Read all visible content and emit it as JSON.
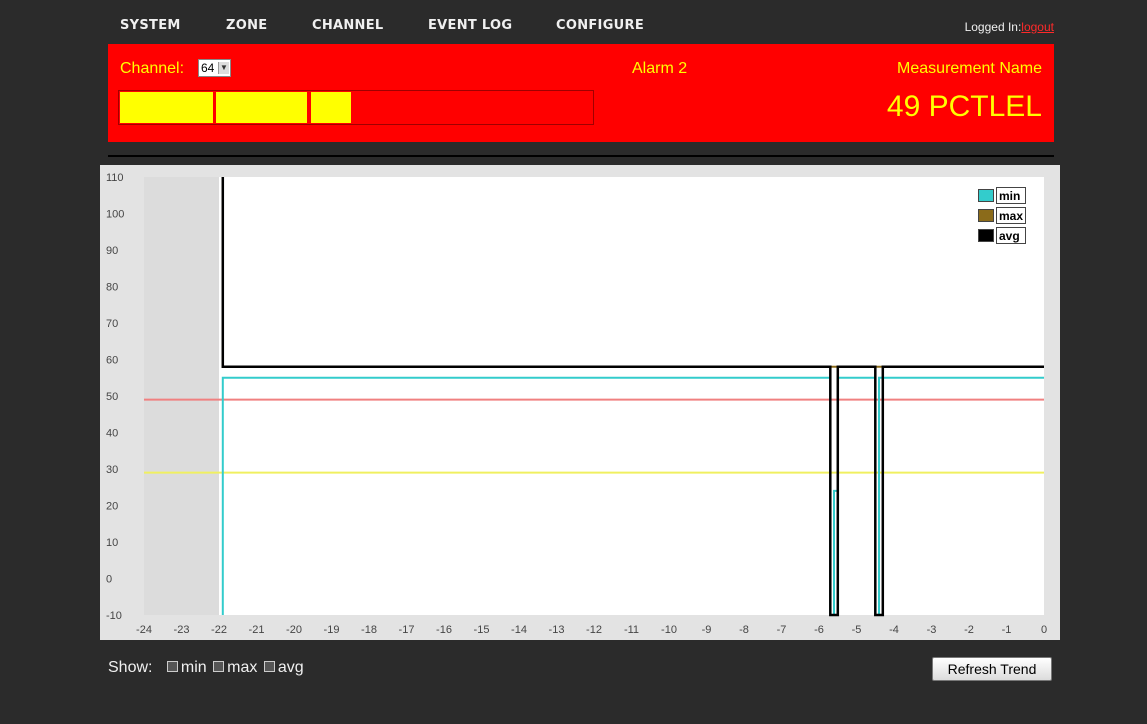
{
  "nav": {
    "items": [
      "SYSTEM",
      "ZONE",
      "CHANNEL",
      "EVENT LOG",
      "CONFIGURE"
    ],
    "logged_in_label": "Logged In:",
    "logout_label": "logout"
  },
  "banner": {
    "channel_label": "Channel:",
    "channel_value": "64",
    "alarm_name": "Alarm 2",
    "measurement_label": "Measurement Name",
    "measurement_value": "49 PCTLEL",
    "level_fraction": 0.49,
    "colors": {
      "background": "#ff0000",
      "text": "#ffff00",
      "fill": "#ffff00"
    }
  },
  "chart_data": {
    "type": "line",
    "title": "",
    "xlabel": "",
    "ylabel": "",
    "x_ticks": [
      -24,
      -23,
      -22,
      -21,
      -20,
      -19,
      -18,
      -17,
      -16,
      -15,
      -14,
      -13,
      -12,
      -11,
      -10,
      -9,
      -8,
      -7,
      -6,
      -5,
      -4,
      -3,
      -2,
      -1,
      0
    ],
    "y_ticks": [
      -10,
      0,
      10,
      20,
      30,
      40,
      50,
      60,
      70,
      80,
      90,
      100,
      110
    ],
    "xlim": [
      -24,
      0
    ],
    "ylim": [
      -10,
      110
    ],
    "grid": false,
    "legend_position": "top-right",
    "no_data_region": [
      -24,
      -22
    ],
    "thresholds": [
      {
        "value": 49,
        "color": "#f08080"
      },
      {
        "value": 29,
        "color": "#f0f060"
      }
    ],
    "series": [
      {
        "name": "min",
        "color": "#33cccc",
        "points": [
          [
            -21.9,
            -10
          ],
          [
            -21.9,
            55
          ],
          [
            -5.7,
            55
          ],
          [
            -5.7,
            -10
          ],
          [
            -5.6,
            -10
          ],
          [
            -5.6,
            24
          ],
          [
            -5.5,
            24
          ],
          [
            -5.5,
            55
          ],
          [
            -4.5,
            55
          ],
          [
            -4.5,
            -10
          ],
          [
            -4.4,
            -10
          ],
          [
            -4.4,
            55
          ],
          [
            0,
            55
          ]
        ]
      },
      {
        "name": "max",
        "color": "#8b6b1a",
        "points": [
          [
            -21.9,
            110
          ],
          [
            -21.9,
            58
          ],
          [
            0,
            58
          ]
        ]
      },
      {
        "name": "avg",
        "color": "#000000",
        "points": [
          [
            -21.9,
            110
          ],
          [
            -21.9,
            58
          ],
          [
            -5.7,
            58
          ],
          [
            -5.7,
            -10
          ],
          [
            -5.5,
            -10
          ],
          [
            -5.5,
            58
          ],
          [
            -4.5,
            58
          ],
          [
            -4.5,
            -10
          ],
          [
            -4.3,
            -10
          ],
          [
            -4.3,
            58
          ],
          [
            0,
            58
          ]
        ]
      }
    ]
  },
  "show": {
    "label": "Show:",
    "options": [
      "min",
      "max",
      "avg"
    ]
  },
  "refresh_label": "Refresh Trend"
}
